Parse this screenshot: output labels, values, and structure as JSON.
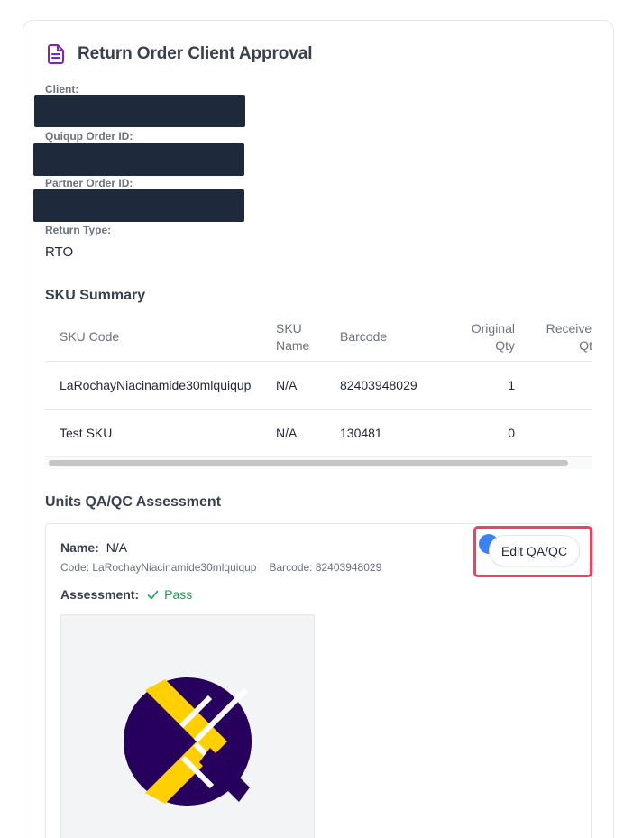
{
  "header": {
    "title": "Return Order Client Approval",
    "icon": "document-text-icon",
    "icon_color": "#7e22ce"
  },
  "fields": {
    "client_label": "Client:",
    "quiqup_order_id_label": "Quiqup Order ID:",
    "partner_order_id_label": "Partner Order ID:",
    "return_type_label": "Return Type:",
    "return_type_value": "RTO"
  },
  "sku_summary": {
    "title": "SKU Summary",
    "columns": [
      "SKU Code",
      "SKU Name",
      "Barcode",
      "Original Qty",
      "Received Qty"
    ],
    "rows": [
      [
        "LaRochayNiacinamide30mlquiqup",
        "N/A",
        "82403948029",
        "1",
        ""
      ],
      [
        "Test SKU",
        "N/A",
        "130481",
        "0",
        ""
      ]
    ]
  },
  "qa": {
    "title": "Units QA/QC Assessment",
    "name_label": "Name:",
    "name_value": "N/A",
    "code_text": "Code: LaRochayNiacinamide30mlquiqup",
    "barcode_text": "Barcode: 82403948029",
    "assessment_label": "Assessment:",
    "assessment_value": "Pass",
    "edit_button": "Edit QA/QC",
    "pass_color": "#16a34a",
    "highlight_color": "#f43f5e"
  },
  "logo": {
    "icon": "quiqup-logo-icon",
    "primary_color": "#27005d",
    "accent_color": "#ffd000"
  }
}
